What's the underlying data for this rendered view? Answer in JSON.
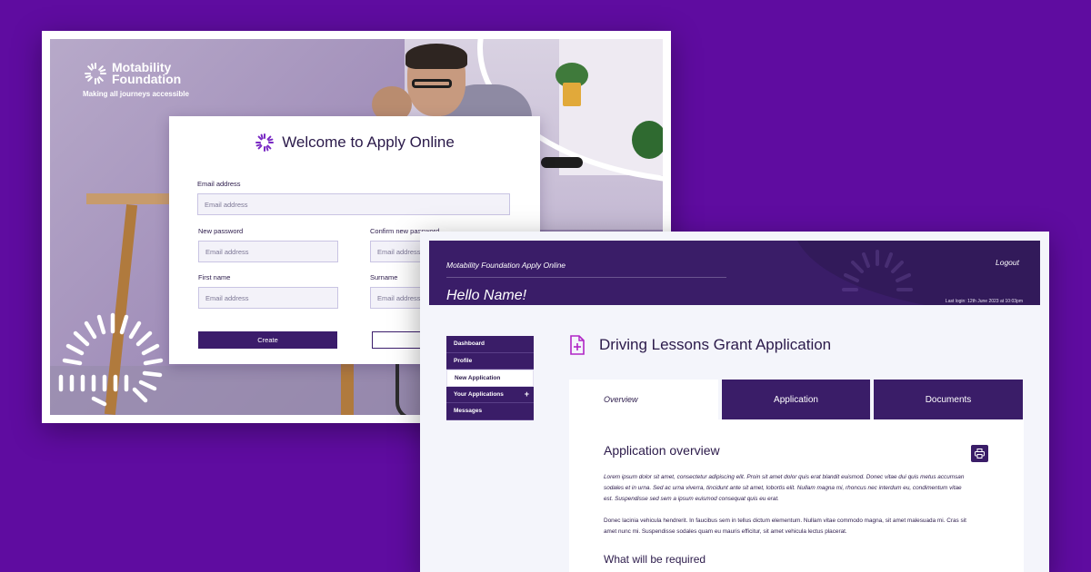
{
  "colors": {
    "background": "#5f0ca0",
    "brand_purple": "#3a1d68",
    "accent_magenta": "#b026c6",
    "input_bg": "#f3f2f9"
  },
  "signup": {
    "brand_name_line1": "Motability",
    "brand_name_line2": "Foundation",
    "brand_tagline": "Making all journeys accessible",
    "title": "Welcome to Apply Online",
    "fields": {
      "email_label": "Email address",
      "email_placeholder": "Email address",
      "new_password_label": "New password",
      "new_password_placeholder": "Email address",
      "confirm_password_label": "Confirm new password",
      "confirm_password_placeholder": "Email address",
      "first_name_label": "First name",
      "first_name_placeholder": "Email address",
      "surname_label": "Surname",
      "surname_placeholder": "Email address"
    },
    "create_button": "Create",
    "icons": [
      "foundation-logo-icon",
      "sunburst-icon"
    ]
  },
  "dashboard": {
    "app_name": "Motability Foundation Apply Online",
    "greeting": "Hello Name!",
    "logout_label": "Logout",
    "last_login": "Last login: 12th June 2023 at 10:03pm",
    "nav": [
      {
        "label": "Dashboard"
      },
      {
        "label": "Profile"
      },
      {
        "label": "New Application",
        "active": true
      },
      {
        "label": "Your Applications",
        "expand": "+"
      },
      {
        "label": "Messages"
      }
    ],
    "page_title": "Driving Lessons Grant Application",
    "page_icon": "document-plus-icon",
    "tabs": [
      {
        "label": "Overview",
        "active": true
      },
      {
        "label": "Application"
      },
      {
        "label": "Documents"
      }
    ],
    "overview": {
      "heading": "Application overview",
      "print_icon": "printer-icon",
      "paragraph1": "Lorem ipsum dolor sit amet, consectetur adipiscing elit. Proin sit amet dolor quis erat blandit euismod. Donec vitae dui quis metus accumsan sodales et in urna. Sed ac urna viverra, tincidunt ante sit amet, lobortis elit. Nullam magna mi, rhoncus nec interdum eu, condimentum vitae est. Suspendisse sed sem a ipsum euismod consequat quis eu erat.",
      "paragraph2": "Donec lacinia vehicula hendrerit. In faucibus sem in tellus dictum elementum. Nullam vitae commodo magna, sit amet malesuada mi. Cras sit amet nunc mi. Suspendisse sodales quam eu mauris efficitur, sit amet vehicula lectus placerat.",
      "requirements_heading": "What will be required"
    }
  }
}
